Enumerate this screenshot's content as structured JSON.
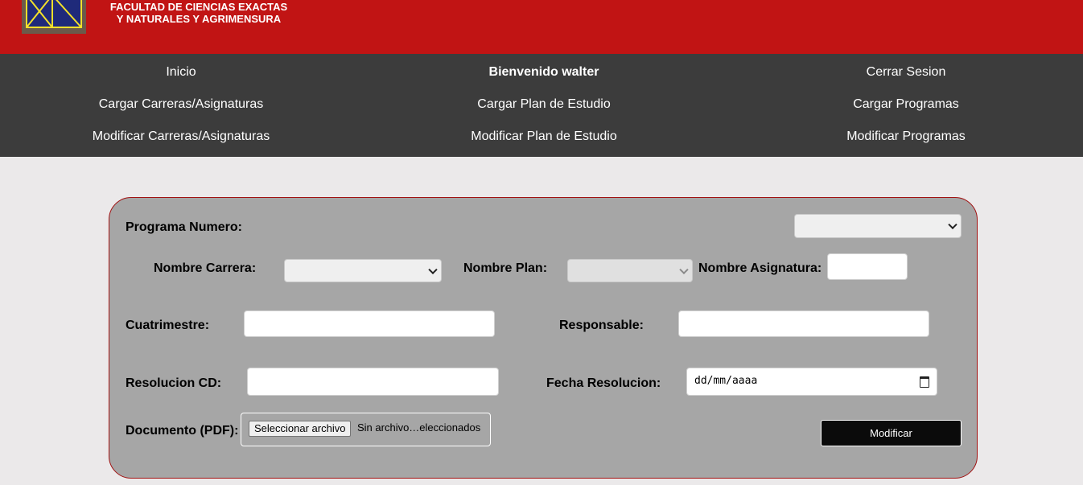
{
  "header": {
    "faculty_line1": "FACULTAD DE CIENCIAS EXACTAS",
    "faculty_line2": "Y NATURALES Y AGRIMENSURA",
    "logo_icon": "university-logo-icon",
    "brand_color": "#c11414"
  },
  "nav": {
    "inicio": "Inicio",
    "welcome": "Bienvenido walter",
    "logout": "Cerrar Sesion",
    "load_careers": "Cargar Carreras/Asignaturas",
    "load_plan": "Cargar Plan de Estudio",
    "load_programs": "Cargar Programas",
    "modify_careers": "Modificar Carreras/Asignaturas",
    "modify_plan": "Modificar Plan de Estudio",
    "modify_programs": "Modificar Programas"
  },
  "form": {
    "program_number_label": "Programa Numero:",
    "program_number_value": "",
    "career_label": "Nombre Carrera:",
    "career_value": "",
    "plan_label": "Nombre Plan:",
    "plan_value": "",
    "subject_label": "Nombre Asignatura:",
    "subject_value": "",
    "semester_label": "Cuatrimestre:",
    "semester_value": "",
    "responsible_label": "Responsable:",
    "responsible_value": "",
    "resolution_label": "Resolucion CD:",
    "resolution_value": "",
    "resolution_date_label": "Fecha Resolucion:",
    "resolution_date_placeholder": "dd/mm/aaaa",
    "document_label": "Documento (PDF):",
    "file_button": "Seleccionar archivo",
    "file_status": "Sin archivo…eleccionados",
    "submit_label": "Modificar"
  }
}
